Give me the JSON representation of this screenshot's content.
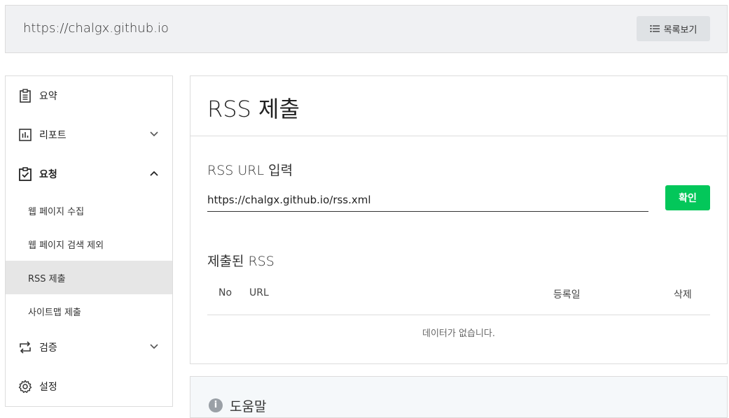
{
  "header": {
    "site_url": "https://chalgx.github.io",
    "list_button_label": "목록보기"
  },
  "sidebar": {
    "items": [
      {
        "label": "요약",
        "icon": "clipboard-icon"
      },
      {
        "label": "리포트",
        "icon": "bar-chart-icon",
        "expanded": false
      },
      {
        "label": "요청",
        "icon": "clipboard-check-icon",
        "expanded": true
      },
      {
        "label": "검증",
        "icon": "repeat-icon",
        "expanded": false
      },
      {
        "label": "설정",
        "icon": "gear-icon"
      }
    ],
    "subitems": [
      {
        "label": "웹 페이지 수집"
      },
      {
        "label": "웹 페이지 검색 제외"
      },
      {
        "label": "RSS 제출",
        "active": true
      },
      {
        "label": "사이트맵 제출"
      }
    ]
  },
  "main": {
    "title": "RSS 제출",
    "input_section_label": "RSS URL 입력",
    "input_value": "https://chalgx.github.io/rss.xml",
    "confirm_label": "확인",
    "submitted_label": "제출된 RSS",
    "columns": [
      "No",
      "URL",
      "등록일",
      "삭제"
    ],
    "empty_message": "데이터가 없습니다."
  },
  "help": {
    "label": "도움말"
  },
  "colors": {
    "accent_green": "#03c75a",
    "active_bg": "#e6e6e6",
    "topbar_bg": "#f0f1f3"
  }
}
